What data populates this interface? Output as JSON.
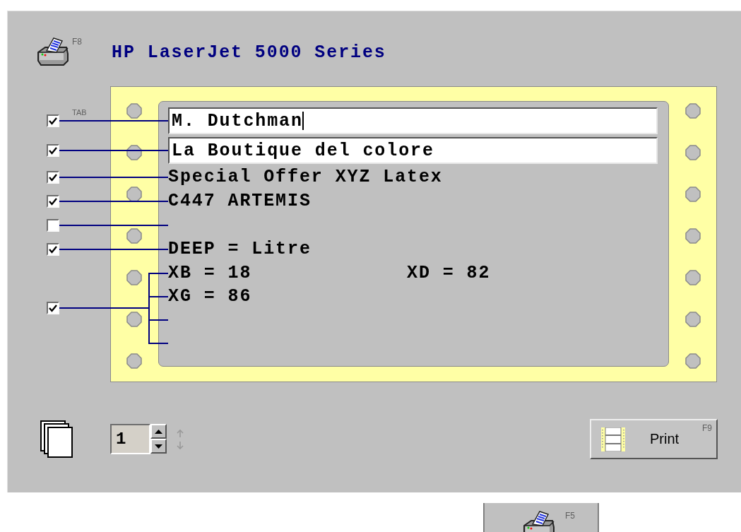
{
  "printer": {
    "name": "HP LaserJet 5000 Series",
    "shortcut": "F8"
  },
  "tab_hint": "TAB",
  "lines": [
    {
      "kind": "field",
      "checked": true,
      "value": "M. Dutchman",
      "focused": true
    },
    {
      "kind": "field",
      "checked": true,
      "value": "La Boutique del colore",
      "focused": false
    },
    {
      "kind": "text",
      "checked": true,
      "cells": [
        "Special Offer XYZ Latex"
      ]
    },
    {
      "kind": "text",
      "checked": true,
      "cells": [
        "C447 ARTEMIS"
      ]
    },
    {
      "kind": "blank",
      "checked": false
    },
    {
      "kind": "text",
      "checked": true,
      "cells": [
        "DEEP = Litre"
      ]
    },
    {
      "kind": "group",
      "checked": true,
      "lines": [
        {
          "kind": "text",
          "cells": [
            "XB = 18",
            "XD = 82"
          ]
        },
        {
          "kind": "text",
          "cells": [
            "XG = 86"
          ]
        },
        {
          "kind": "blank"
        },
        {
          "kind": "blank"
        }
      ]
    }
  ],
  "copies": {
    "value": "1"
  },
  "print_button": {
    "label": "Print",
    "shortcut": "F9"
  },
  "bottom_tab": {
    "shortcut": "F5"
  }
}
